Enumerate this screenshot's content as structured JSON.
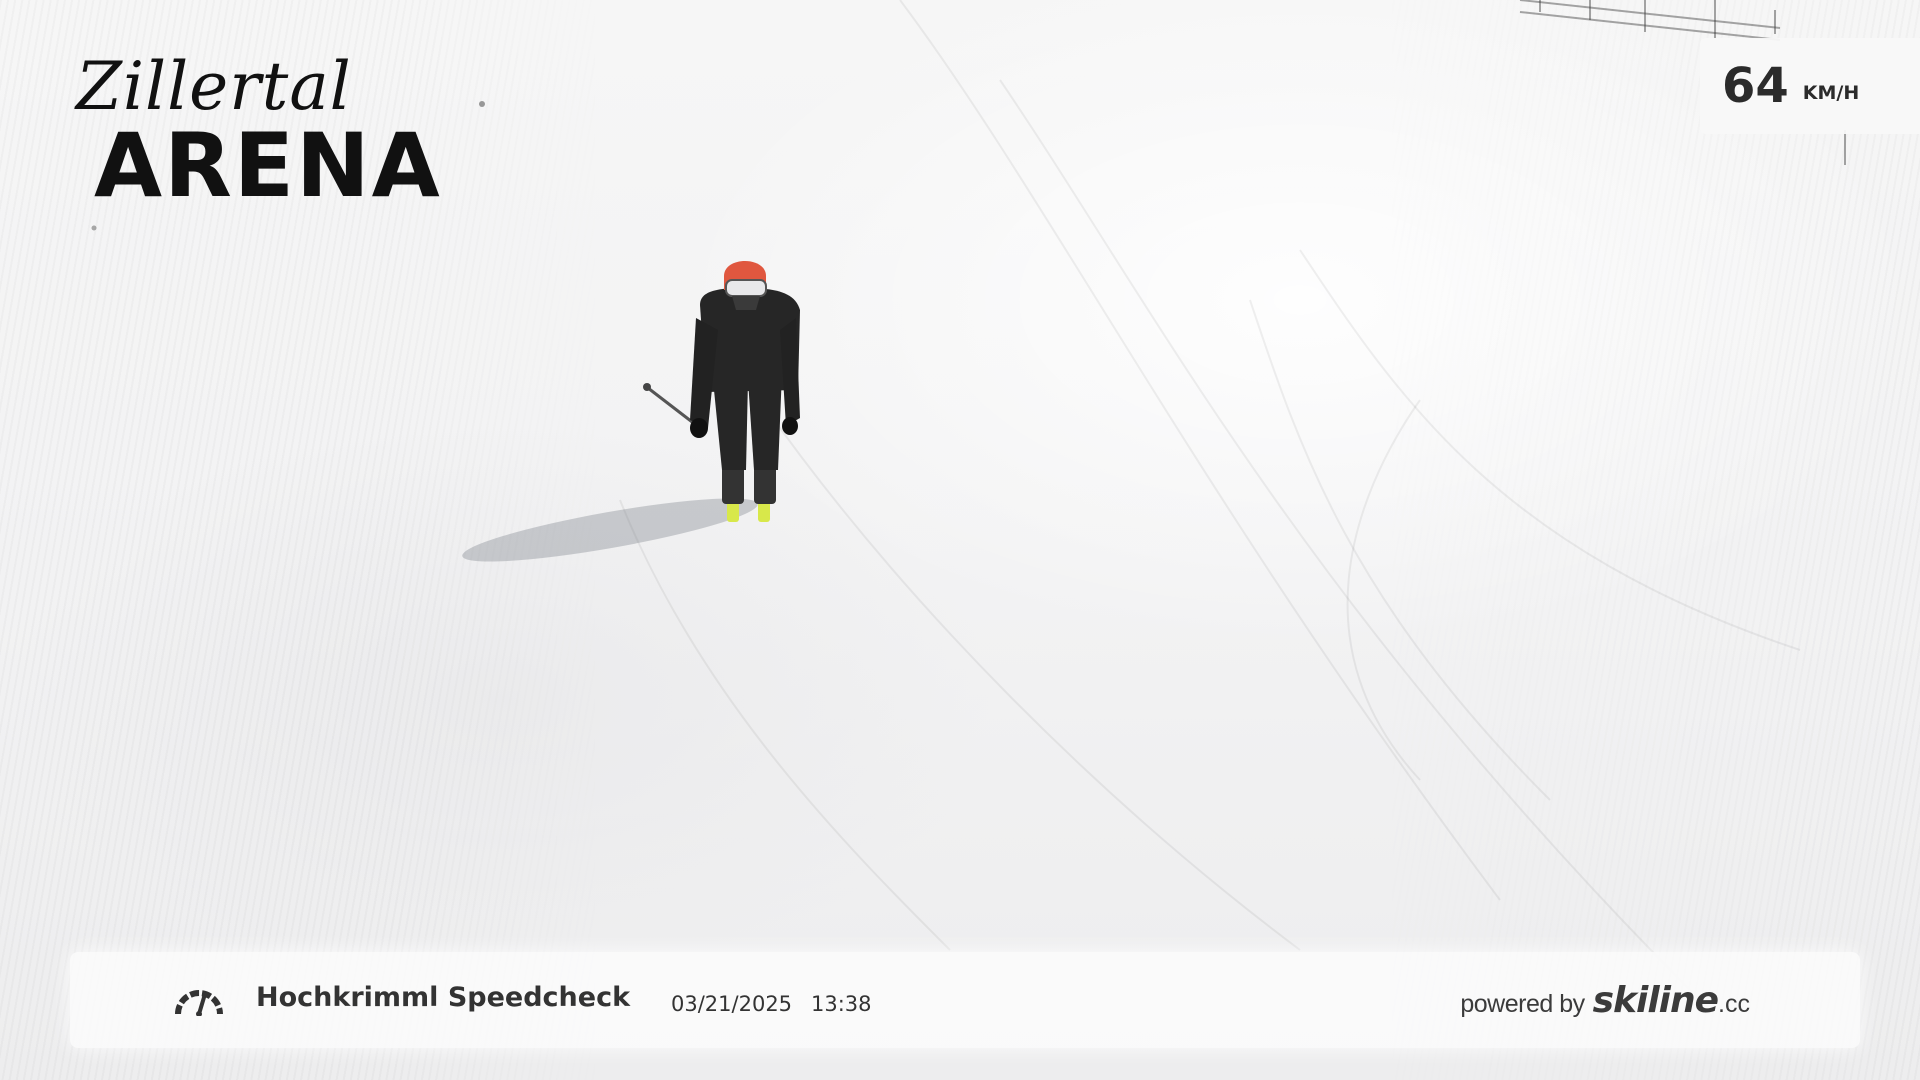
{
  "logo": {
    "script_text": "Zillertal",
    "block_text": "ARENA"
  },
  "speed": {
    "value": "64",
    "unit": "KM/H"
  },
  "info_bar": {
    "icon": "speedometer-icon",
    "title": "Hochkrimml Speedcheck",
    "date": "03/21/2025",
    "time": "13:38",
    "powered_by_label": "powered by",
    "brand_name": "skiline",
    "brand_tld": ".cc"
  },
  "colors": {
    "snow": "#f4f4f4",
    "text_dark": "#2b2b2b",
    "helmet": "#e0573f",
    "ski_tips": "#d8e84a",
    "jacket": "#262626"
  }
}
